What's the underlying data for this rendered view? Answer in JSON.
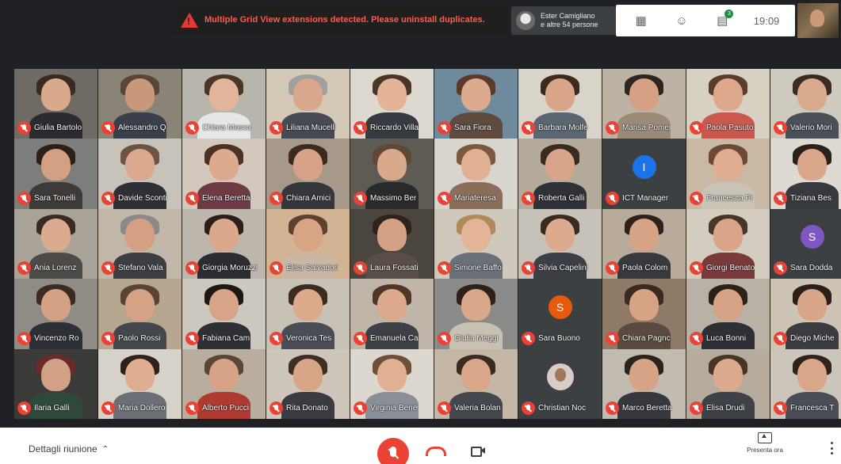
{
  "banner": {
    "warning_text": "Multiple Grid View extensions detected. Please uninstall duplicates.",
    "host_name": "Ester Camigliano",
    "host_others": "e altre 54 persone",
    "time": "19:09",
    "badge_count": "3"
  },
  "participants": [
    {
      "name": "Giulia Bartolo",
      "bg": "#6f6a63",
      "skin": "#d8a98a",
      "hair": "#3a2a20",
      "shirt": "#2c2c30"
    },
    {
      "name": "Alessandro Q",
      "bg": "#8a8478",
      "skin": "#c7987a",
      "hair": "#5a4636",
      "shirt": "#3a3f4a"
    },
    {
      "name": "Chiara Mosca",
      "bg": "#b8b5ad",
      "skin": "#e2b59a",
      "hair": "#4a3528",
      "shirt": "#e6e6e6"
    },
    {
      "name": "Liliana Mucelli",
      "bg": "#d4c9b6",
      "skin": "#d8a78c",
      "hair": "#a0a0a0",
      "shirt": "#474a52"
    },
    {
      "name": "Riccardo Villa",
      "bg": "#ddd8d0",
      "skin": "#e4b397",
      "hair": "#4a3527",
      "shirt": "#373a40"
    },
    {
      "name": "Sara Fiora",
      "bg": "#6f8a9c",
      "skin": "#dcab8f",
      "hair": "#5a3a2a",
      "shirt": "#5f4a3e"
    },
    {
      "name": "Barbara Molfe",
      "bg": "#d9d4ca",
      "skin": "#d9a588",
      "hair": "#3c2a20",
      "shirt": "#5b6670"
    },
    {
      "name": "Marisa Pomei",
      "bg": "#bdb2a3",
      "skin": "#d6a084",
      "hair": "#2e2420",
      "shirt": "#9a8a78"
    },
    {
      "name": "Paola Pasuto",
      "bg": "#d7d1c4",
      "skin": "#dda88b",
      "hair": "#5a3d2c",
      "shirt": "#c9584f"
    },
    {
      "name": "Valerio Mori",
      "bg": "#cfcac0",
      "skin": "#d9ab8e",
      "hair": "#3a2c24",
      "shirt": "#4a4f58"
    },
    {
      "name": "Sara Tonelli",
      "bg": "#7d7e7c",
      "skin": "#d4a083",
      "hair": "#2c201a",
      "shirt": "#3e3a38"
    },
    {
      "name": "Davide Sconti",
      "bg": "#c7c3ba",
      "skin": "#dba98d",
      "hair": "#6b5444",
      "shirt": "#2e3036"
    },
    {
      "name": "Elena Beretta",
      "bg": "#d2c8bd",
      "skin": "#deaa8d",
      "hair": "#4a3226",
      "shirt": "#6e3a44"
    },
    {
      "name": "Chiara Amici",
      "bg": "#a7998a",
      "skin": "#d7a287",
      "hair": "#3c2a20",
      "shirt": "#35363b"
    },
    {
      "name": "Massimo Ber",
      "bg": "#5e5a54",
      "skin": "#d9a98c",
      "hair": "#5e4838",
      "shirt": "#2a2a2c"
    },
    {
      "name": "Mariateresa",
      "bg": "#d8d5ce",
      "skin": "#e1b093",
      "hair": "#7a5a3e",
      "shirt": "#8a6e5a"
    },
    {
      "name": "Roberta Galli",
      "bg": "#b4aa9c",
      "skin": "#d8a58a",
      "hair": "#3a2a20",
      "shirt": "#2f3138"
    },
    {
      "name": "ICT Manager",
      "bg": "#3c4043",
      "letter": "I",
      "letterColor": "#1a73e8"
    },
    {
      "name": "Francesca Pr",
      "bg": "#c9b9a4",
      "skin": "#e0ad90",
      "hair": "#6a4a34",
      "shirt": "#c9c3b6"
    },
    {
      "name": "Tiziana Bes",
      "bg": "#dedad3",
      "skin": "#dba78a",
      "hair": "#2a211c",
      "shirt": "#37393e"
    },
    {
      "name": "Ania Lorenz",
      "bg": "#a9a39a",
      "skin": "#dbab8f",
      "hair": "#3a2b22",
      "shirt": "#4d4a48"
    },
    {
      "name": "Stefano Vala",
      "bg": "#c1b8aa",
      "skin": "#d49f83",
      "hair": "#8a8a8a",
      "shirt": "#3c3e44"
    },
    {
      "name": "Giorgia Moruzzi",
      "bg": "#bdb6ad",
      "skin": "#dca88b",
      "hair": "#2a1f1a",
      "shirt": "#2c2d32"
    },
    {
      "name": "Elisa Salvadori",
      "bg": "#d2b494",
      "skin": "#d8a486",
      "hair": "#5d4130",
      "shirt": "#c9b7a3"
    },
    {
      "name": "Laura Fossati",
      "bg": "#4b4540",
      "skin": "#d5a185",
      "hair": "#2e231c",
      "shirt": "#5a4f48"
    },
    {
      "name": "Simone Baffo",
      "bg": "#cfc8bd",
      "skin": "#e3b497",
      "hair": "#b08a5a",
      "shirt": "#6a7078"
    },
    {
      "name": "Silvia Capelini",
      "bg": "#c6c2b9",
      "skin": "#dcaa8d",
      "hair": "#3a2a20",
      "shirt": "#3c3f46"
    },
    {
      "name": "Paola Colom",
      "bg": "#b9ab9a",
      "skin": "#d7a386",
      "hair": "#2c211b",
      "shirt": "#37393f"
    },
    {
      "name": "Giorgi Benato",
      "bg": "#d3cdc1",
      "skin": "#d9a487",
      "hair": "#4a3628",
      "shirt": "#7a3a3a"
    },
    {
      "name": "Sara Dodda",
      "bg": "#3c4043",
      "letter": "S",
      "letterColor": "#7e57c2"
    },
    {
      "name": "Vincenzo Ro",
      "bg": "#8f8c86",
      "skin": "#d5a184",
      "hair": "#3a2c24",
      "shirt": "#2d3036"
    },
    {
      "name": "Paolo Rossi",
      "bg": "#b6a58f",
      "skin": "#d5a285",
      "hair": "#5a4334",
      "shirt": "#43464d"
    },
    {
      "name": "Fabiana Cam",
      "bg": "#ccc7bf",
      "skin": "#d8a488",
      "hair": "#1e1814",
      "shirt": "#2f3035"
    },
    {
      "name": "Veronica Tes",
      "bg": "#c8c1b5",
      "skin": "#dca98b",
      "hair": "#3c2b21",
      "shirt": "#4a4d55"
    },
    {
      "name": "Emanuela Ca",
      "bg": "#bfb5a8",
      "skin": "#dba98c",
      "hair": "#4e3729",
      "shirt": "#3d4046"
    },
    {
      "name": "Giulia Meggi",
      "bg": "#8a8a88",
      "skin": "#d9a78a",
      "hair": "#2d221b",
      "shirt": "#c8c0b0"
    },
    {
      "name": "Sara Buono",
      "bg": "#3c4043",
      "letter": "S",
      "letterColor": "#e8590c"
    },
    {
      "name": "Chiara Pagnc",
      "bg": "#8e7a66",
      "skin": "#d7a385",
      "hair": "#3a2a20",
      "shirt": "#5a4a40"
    },
    {
      "name": "Luca Bonni",
      "bg": "#b9b1a6",
      "skin": "#d6a286",
      "hair": "#2b211b",
      "shirt": "#2f3036"
    },
    {
      "name": "Diego Miche",
      "bg": "#cdc4b6",
      "skin": "#d9a588",
      "hair": "#2a1f19",
      "shirt": "#3a3c42"
    },
    {
      "name": "Ilaria Galli",
      "bg": "#3a3a38",
      "skin": "#d2a084",
      "hair": "#6a2a2a",
      "shirt": "#2f4a3a"
    },
    {
      "name": "Maria Dollero",
      "bg": "#d6d2ca",
      "skin": "#dfae91",
      "hair": "#2e231c",
      "shirt": "#6b6e74"
    },
    {
      "name": "Alberto Pucci",
      "bg": "#b8ad9e",
      "skin": "#d7a386",
      "hair": "#5a4536",
      "shirt": "#b03a30"
    },
    {
      "name": "Rita Donato",
      "bg": "#cfc6bb",
      "skin": "#d8a587",
      "hair": "#3e2e24",
      "shirt": "#3a3c42"
    },
    {
      "name": "Virginia Bene",
      "bg": "#dcd8d0",
      "skin": "#e1af91",
      "hair": "#6e5038",
      "shirt": "#8a8e96"
    },
    {
      "name": "Valeria Bolan",
      "bg": "#c4b7a6",
      "skin": "#d9a689",
      "hair": "#3a2b21",
      "shirt": "#44474e"
    },
    {
      "name": "Christian Noc",
      "bg": "#3c4043",
      "cam": true
    },
    {
      "name": "Marco Beretta",
      "bg": "#c1bbb1",
      "skin": "#d7a386",
      "hair": "#2c231d",
      "shirt": "#36383e"
    },
    {
      "name": "Elisa Drudi",
      "bg": "#b5ab9f",
      "skin": "#dcaa8d",
      "hair": "#4a3426",
      "shirt": "#3e4148"
    },
    {
      "name": "Francesca T",
      "bg": "#cbc5bb",
      "skin": "#d9a689",
      "hair": "#2f241d",
      "shirt": "#4a4d55"
    }
  ],
  "bottom": {
    "details_label": "Dettagli riunione",
    "present_label": "Presenta ora"
  }
}
